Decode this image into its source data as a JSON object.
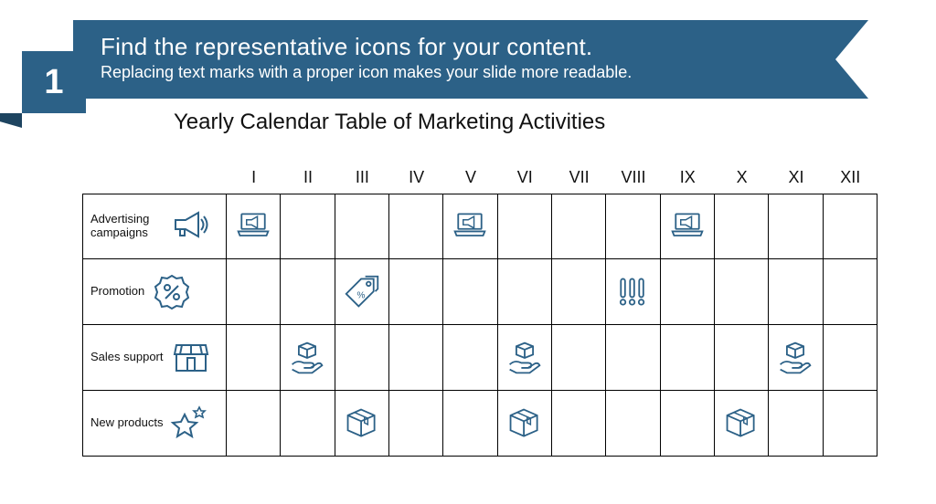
{
  "banner": {
    "number": "1",
    "headline": "Find the representative icons for your content.",
    "sub": "Replacing text marks with a proper icon makes your slide more readable."
  },
  "subtitle": "Yearly Calendar Table of Marketing Activities",
  "months": [
    "I",
    "II",
    "III",
    "IV",
    "V",
    "VI",
    "VII",
    "VIII",
    "IX",
    "X",
    "XI",
    "XII"
  ],
  "iconColor": "#2c6187",
  "rows": [
    {
      "label": "Advertising campaigns",
      "rowIcon": "megaphone",
      "cells": {
        "0": "laptop-ad",
        "4": "laptop-ad",
        "8": "laptop-ad"
      }
    },
    {
      "label": "Promotion",
      "rowIcon": "percent-badge",
      "cells": {
        "2": "price-tags",
        "7": "exclaims"
      }
    },
    {
      "label": "Sales support",
      "rowIcon": "storefront",
      "cells": {
        "1": "hand-box",
        "5": "hand-box",
        "10": "hand-box"
      }
    },
    {
      "label": "New products",
      "rowIcon": "stars",
      "cells": {
        "2": "box",
        "5": "box",
        "9": "box"
      }
    }
  ]
}
